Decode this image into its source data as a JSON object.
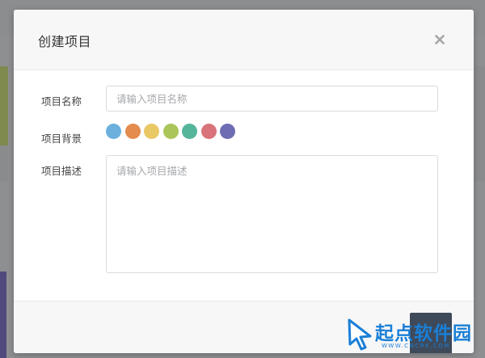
{
  "modal": {
    "title": "创建项目",
    "fields": {
      "name_label": "项目名称",
      "name_placeholder": "请输入项目名称",
      "background_label": "项目背景",
      "description_label": "项目描述",
      "description_placeholder": "请输入项目描述"
    },
    "background_colors": [
      "#6cb0dd",
      "#e48b4e",
      "#e9c866",
      "#abc55a",
      "#55b59a",
      "#d9747a",
      "#6e6cb3"
    ]
  },
  "watermark": {
    "logo_text": "起点软件园",
    "url_text": "WWW.CNCRK.COM"
  }
}
